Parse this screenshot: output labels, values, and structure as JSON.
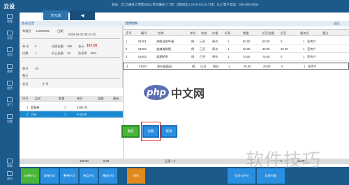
{
  "app": {
    "logo": "云设",
    "tabs": [
      "开元单",
      "◀"
    ],
    "top_info": "收员：[汇之通员工零售]SEQ:单位编号 / 门店：[测试店] / 2019-04-22  门店：[1] / 客户电话：400-000-0000"
  },
  "sidebar": {
    "items": [
      "收银",
      "交班",
      "会员",
      "查询",
      "退货",
      "开门",
      "设置"
    ],
    "bottom": [
      "帮助",
      "退出"
    ]
  },
  "form": {
    "title": "会员信息",
    "fields": [
      {
        "label": "单据号",
        "value": "L0000003"
      },
      {
        "label": "日期",
        "value": "2019-04-22 06:47:43"
      },
      {
        "label": "单 价",
        "value": "0"
      },
      {
        "label": "应收金额",
        "value": "185"
      },
      {
        "label": "合计",
        "value": "167.00"
      },
      {
        "label": "优惠",
        "value": "1"
      },
      {
        "label": "折让金额",
        "value": "18"
      },
      {
        "label": "折扣率",
        "value": "90%"
      },
      {
        "label": "积分",
        "value": "19"
      },
      {
        "label": "备注",
        "value": ""
      },
      {
        "label": "会员",
        "value": ""
      },
      {
        "label": "卡 号",
        "value": ""
      }
    ],
    "total_label": "合计",
    "total_value": "167.00"
  },
  "left_list": {
    "headers": [
      "序号",
      "品名",
      "数量",
      "单价",
      "金额",
      "赠送"
    ],
    "rows": [
      {
        "no": "1",
        "name": "套餐卷",
        "qty": "1",
        "price": "¥185.00",
        "amount": "",
        "gift": ""
      },
      {
        "no": "2",
        "name": "小计",
        "qty": "1",
        "price": "¥-18.00",
        "amount": "",
        "gift": ""
      }
    ],
    "footer": [
      "185.00",
      "0.00"
    ]
  },
  "table": {
    "title": "消费明细",
    "refresh": "返回",
    "headers": [
      "序号",
      "编号",
      "名称",
      "单位",
      "状态",
      "价格",
      "折扣",
      "数量",
      "折后金额",
      "折后",
      "服务员",
      "备注"
    ],
    "rows": [
      {
        "no": "1",
        "code": "01001",
        "name": "海鲜自助午餐",
        "unit": "例",
        "status": "已开",
        "price": "原价",
        "disc": "1",
        "qty": "50.00",
        "amt": "50.00",
        "after": "0",
        "waiter": "1",
        "note": "宣传户"
      },
      {
        "no": "2",
        "code": "01002",
        "name": "香辣海鲜锅",
        "unit": "例",
        "status": "已开",
        "price": "原价",
        "disc": "1",
        "qty": "30.00",
        "amt": "30.00",
        "after": "30.00",
        "waiter": "1",
        "note": "宣传户"
      },
      {
        "no": "3",
        "code": "01003",
        "name": "清蒸鲈鱼",
        "unit": "例",
        "status": "已开",
        "price": "原价",
        "disc": "1",
        "qty": "75.00",
        "amt": "75.00",
        "after": "0",
        "waiter": "1",
        "note": "宣传户"
      },
      {
        "no": "4",
        "code": "01007",
        "name": "茶叶蛋菌汤",
        "unit": "例",
        "status": "已开",
        "price": "原价",
        "disc": "1",
        "qty": "20.00",
        "amt": "20.00",
        "after": "0",
        "waiter": "1",
        "note": "宣传户"
      }
    ],
    "footer": [
      "记录：4",
      "0",
      "15.00"
    ]
  },
  "popup": {
    "buttons": [
      "确定",
      "付款",
      "取消"
    ]
  },
  "function_bar": [
    "挂单(F1)",
    "取单(F2)",
    "整单(F3)",
    "单品(F4)",
    "赠送(F5)",
    "现金",
    "会员卡(F8)",
    "其他付款"
  ],
  "watermarks": {
    "php_logo": "php",
    "php_text": "中文网",
    "jq_text": "软件技巧"
  },
  "colors": {
    "header": "#1d5a8c",
    "accent_blue": "#2a8fe0",
    "accent_green": "#49b53b",
    "accent_orange": "#e08a1e",
    "highlight": "#e02020",
    "total_red": "#d0302a"
  }
}
